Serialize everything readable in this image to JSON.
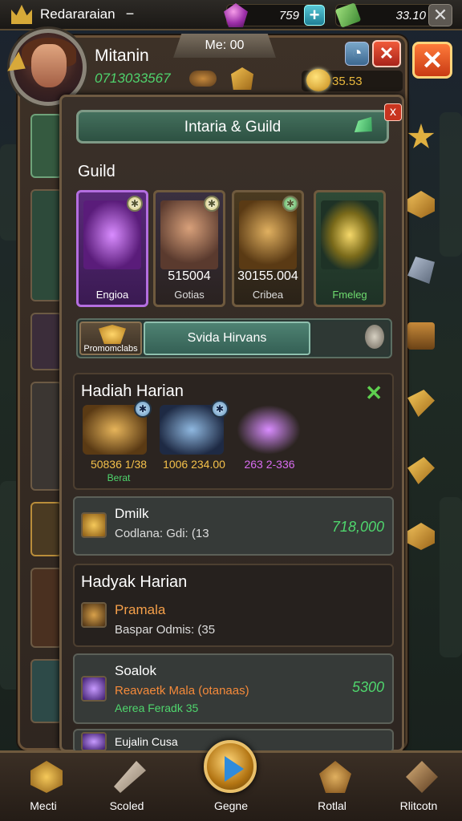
{
  "top_bar": {
    "player_tag": "Redararaian",
    "minus_symbol": "−",
    "gems": "759",
    "cash": "33.10",
    "plus_symbol": "+",
    "close_symbol": "✕"
  },
  "header": {
    "title_plate": "Me: 00",
    "player_name": "Mitanin",
    "player_id": "0713033567",
    "gold_value": "35.53",
    "info_symbol": "◔",
    "close_symbol": "✕"
  },
  "guild": {
    "banner": "Intaria & Guild",
    "banner_close": "x",
    "section_title": "Guild",
    "cards": [
      {
        "number": "",
        "label": "Engioa",
        "badge": "✱"
      },
      {
        "number": "515004",
        "label": "Gotias",
        "badge": "✱"
      },
      {
        "number": "30155.004",
        "label": "Cribea",
        "badge": "✱"
      },
      {
        "number": "",
        "label": "Fmeleg",
        "badge": ""
      }
    ]
  },
  "tabs": {
    "left_label": "Promomclabs",
    "middle_label": "Svida Hirvans"
  },
  "daily": {
    "title": "Hadiah Harian",
    "close_symbol": "✕",
    "rewards": [
      {
        "value": "50836 1/38",
        "sub": "Berat",
        "badge": "✱"
      },
      {
        "value": "1006 234.00",
        "sub": "",
        "badge": "✱"
      },
      {
        "value": "263 2-336",
        "sub": "",
        "badge": ""
      }
    ]
  },
  "rows": [
    {
      "title": "Dmilk",
      "subtitle": "Codlana: Gdi: (13",
      "value": "718,000"
    },
    {
      "title": "Pramala",
      "subtitle": "Baspar Odmis: (35",
      "value": ""
    },
    {
      "title": "Soalok",
      "subtitle": "Reavaetk Mala (otanaas)",
      "sub2": "Aerea Feradk 35",
      "value": "5300"
    },
    {
      "title": "Eujalin Cusa",
      "subtitle": "",
      "value": ""
    }
  ],
  "section2_title": "Hadyak Harian",
  "bottom_nav": [
    {
      "label": "Mecti"
    },
    {
      "label": "Scoled"
    },
    {
      "label": "Gegne"
    },
    {
      "label": "Rotlal"
    },
    {
      "label": "Rlitcotn"
    }
  ],
  "colors": {
    "accent_green": "#4fd66d",
    "gold": "#e8b83d",
    "close_red": "#c8341f"
  }
}
